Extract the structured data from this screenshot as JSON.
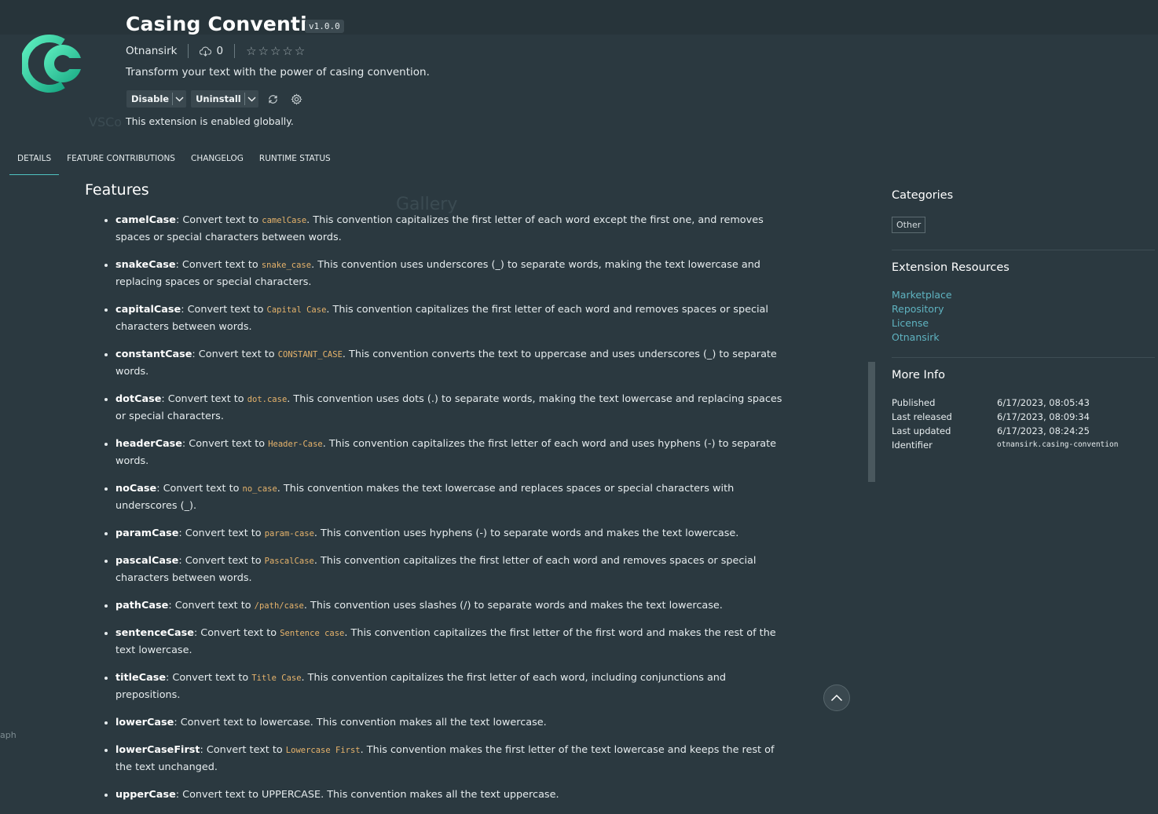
{
  "header": {
    "title": "Casing Convention",
    "version": "v1.0.0",
    "publisher": "Otnansirk",
    "installs": "0",
    "rating_stars": "☆☆☆☆☆",
    "description": "Transform your text with the power of casing convention.",
    "status": "This extension is enabled globally."
  },
  "actions": {
    "disable_label": "Disable",
    "uninstall_label": "Uninstall"
  },
  "tabs": [
    "DETAILS",
    "FEATURE CONTRIBUTIONS",
    "CHANGELOG",
    "RUNTIME STATUS"
  ],
  "features": {
    "heading": "Features",
    "items": [
      {
        "name": "camelCase",
        "pre": ": Convert text to ",
        "code": "camelCase",
        "post": ". This convention capitalizes the first letter of each word except the first one, and removes spaces or special characters between words."
      },
      {
        "name": "snakeCase",
        "pre": ": Convert text to ",
        "code": "snake_case",
        "post": ". This convention uses underscores (_) to separate words, making the text lowercase and replacing spaces or special characters."
      },
      {
        "name": "capitalCase",
        "pre": ": Convert text to ",
        "code": "Capital Case",
        "post": ". This convention capitalizes the first letter of each word and removes spaces or special characters between words."
      },
      {
        "name": "constantCase",
        "pre": ": Convert text to ",
        "code": "CONSTANT_CASE",
        "post": ". This convention converts the text to uppercase and uses underscores (_) to separate words."
      },
      {
        "name": "dotCase",
        "pre": ": Convert text to ",
        "code": "dot.case",
        "post": ". This convention uses dots (.) to separate words, making the text lowercase and replacing spaces or special characters."
      },
      {
        "name": "headerCase",
        "pre": ": Convert text to ",
        "code": "Header-Case",
        "post": ". This convention capitalizes the first letter of each word and uses hyphens (-) to separate words."
      },
      {
        "name": "noCase",
        "pre": ": Convert text to ",
        "code": "no_case",
        "post": ". This convention makes the text lowercase and replaces spaces or special characters with underscores (_)."
      },
      {
        "name": "paramCase",
        "pre": ": Convert text to ",
        "code": "param-case",
        "post": ". This convention uses hyphens (-) to separate words and makes the text lowercase."
      },
      {
        "name": "pascalCase",
        "pre": ": Convert text to ",
        "code": "PascalCase",
        "post": ". This convention capitalizes the first letter of each word and removes spaces or special characters between words."
      },
      {
        "name": "pathCase",
        "pre": ": Convert text to ",
        "code": "/path/case",
        "post": ". This convention uses slashes (/) to separate words and makes the text lowercase."
      },
      {
        "name": "sentenceCase",
        "pre": ": Convert text to ",
        "code": "Sentence case",
        "post": ". This convention capitalizes the first letter of the first word and makes the rest of the text lowercase."
      },
      {
        "name": "titleCase",
        "pre": ": Convert text to ",
        "code": "Title Case",
        "post": ". This convention capitalizes the first letter of each word, including conjunctions and prepositions."
      },
      {
        "name": "lowerCase",
        "pre": ": Convert text to lowercase. This convention makes all the text lowercase.",
        "code": "",
        "post": ""
      },
      {
        "name": "lowerCaseFirst",
        "pre": ": Convert text to ",
        "code": "Lowercase First",
        "post": ". This convention makes the first letter of the text lowercase and keeps the rest of the text unchanged."
      },
      {
        "name": "upperCase",
        "pre": ": Convert text to UPPERCASE. This convention makes all the text uppercase.",
        "code": "",
        "post": ""
      }
    ]
  },
  "sidebar": {
    "categories_heading": "Categories",
    "category": "Other",
    "resources_heading": "Extension Resources",
    "resources": [
      "Marketplace",
      "Repository",
      "License",
      "Otnansirk"
    ],
    "more_info_heading": "More Info",
    "info": [
      {
        "key": "Published",
        "value": "6/17/2023, 08:05:43"
      },
      {
        "key": "Last released",
        "value": "6/17/2023, 08:09:34"
      },
      {
        "key": "Last updated",
        "value": "6/17/2023, 08:24:25"
      },
      {
        "key": "Identifier",
        "value": "otnansirk.casing-convention"
      }
    ]
  },
  "ghost_text": {
    "gallery": "Gallery",
    "vsc": "VSCo"
  },
  "footer": {
    "left_fragment": "aph"
  },
  "colors": {
    "background": "#2b3940",
    "accent": "#4fc3c0",
    "link": "#5fb3c0",
    "code": "#e6b36b",
    "logo_start": "#4ee6b0",
    "logo_end": "#1fae8a"
  },
  "icons": {
    "cloud": "cloud-download-icon",
    "sync": "sync-icon",
    "gear": "gear-icon",
    "up": "chevron-up-icon"
  }
}
